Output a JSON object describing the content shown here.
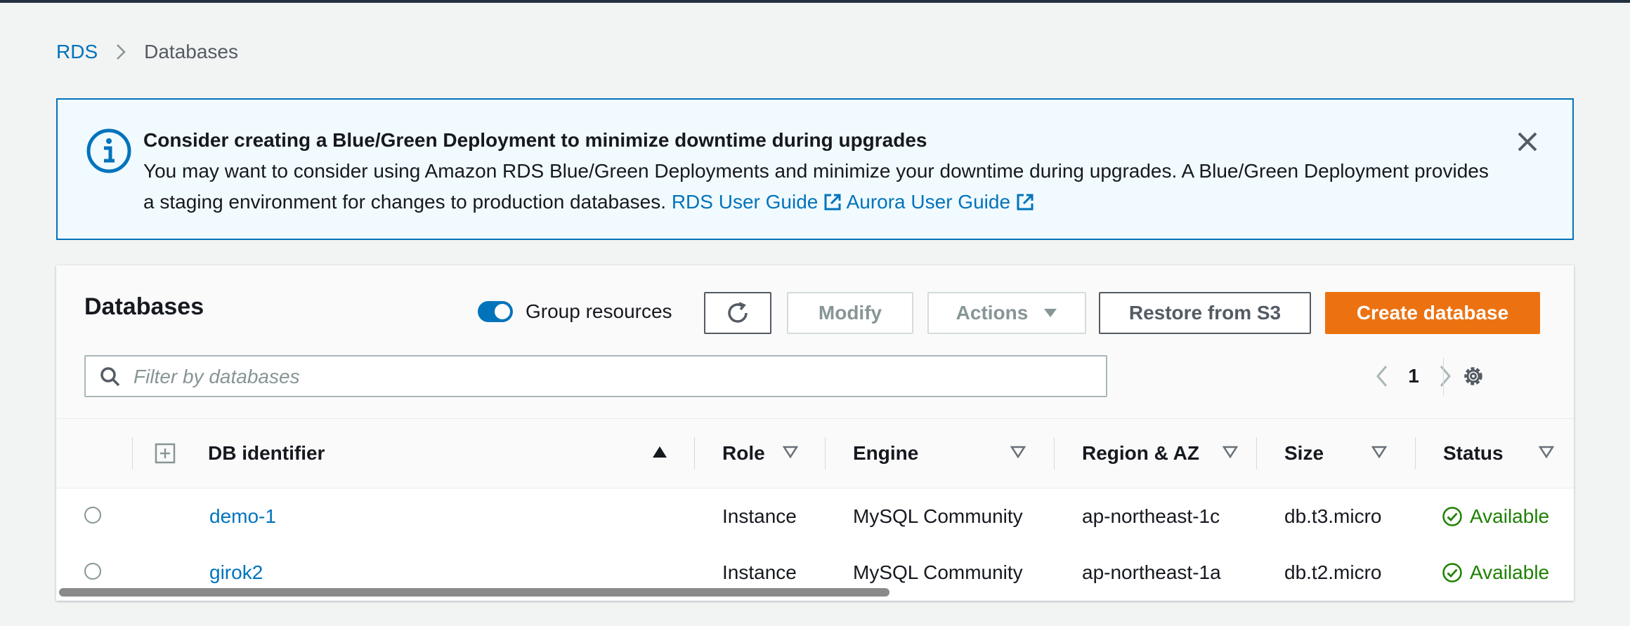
{
  "breadcrumb": {
    "root": "RDS",
    "current": "Databases"
  },
  "banner": {
    "title": "Consider creating a Blue/Green Deployment to minimize downtime during upgrades",
    "body": "You may want to consider using Amazon RDS Blue/Green Deployments and minimize your downtime during upgrades. A Blue/Green Deployment provides a staging environment for changes to production databases.",
    "link_rds": "RDS User Guide",
    "link_aurora": "Aurora User Guide",
    "accent": "#0073bb"
  },
  "panel": {
    "title": "Databases",
    "group_resources_label": "Group resources",
    "group_resources_on": true,
    "modify_label": "Modify",
    "actions_label": "Actions",
    "restore_label": "Restore from S3",
    "create_label": "Create database",
    "create_color": "#ec7211",
    "search_placeholder": "Filter by databases",
    "page": "1"
  },
  "table": {
    "columns": {
      "db_identifier": "DB identifier",
      "role": "Role",
      "engine": "Engine",
      "region": "Region & AZ",
      "size": "Size",
      "status": "Status"
    },
    "rows": [
      {
        "id": "demo-1",
        "role": "Instance",
        "engine": "MySQL Community",
        "region": "ap-northeast-1c",
        "size": "db.t3.micro",
        "status": "Available"
      },
      {
        "id": "girok2",
        "role": "Instance",
        "engine": "MySQL Community",
        "region": "ap-northeast-1a",
        "size": "db.t2.micro",
        "status": "Available"
      }
    ]
  },
  "icons": [
    "info-icon",
    "close-icon",
    "external-link-icon",
    "refresh-icon",
    "caret-down-icon",
    "search-icon",
    "chevron-left-icon",
    "chevron-right-icon",
    "settings-icon",
    "expand-icon",
    "sort-asc-icon",
    "sort-icon",
    "check-circle-icon"
  ]
}
